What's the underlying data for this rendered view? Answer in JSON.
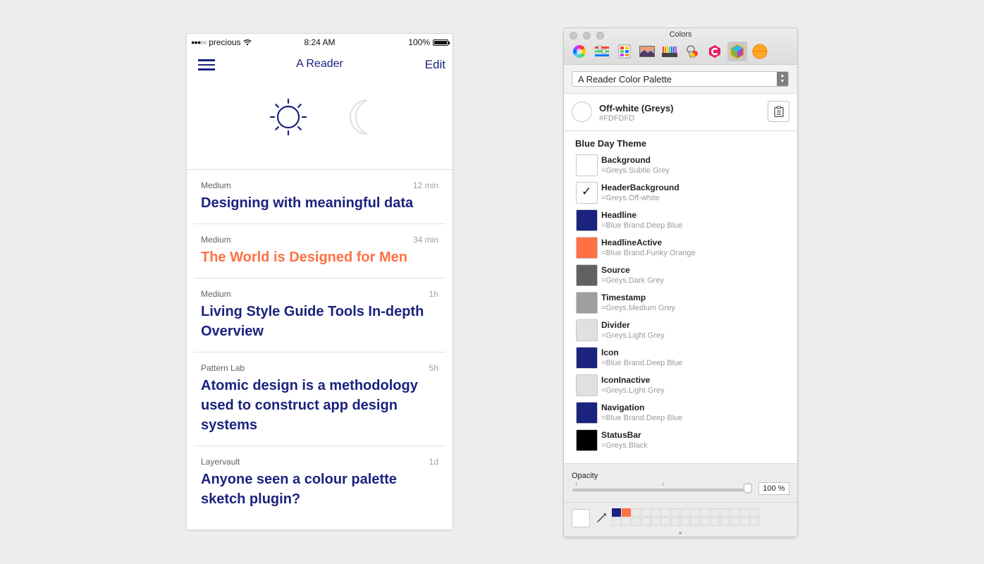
{
  "phone": {
    "statusbar": {
      "carrier": "precious",
      "time": "8:24 AM",
      "battery": "100%"
    },
    "navbar": {
      "title": "A Reader",
      "edit_label": "Edit"
    },
    "theme_toggle": {
      "day_icon": "sun-icon",
      "night_icon": "moon-icon",
      "selected": "day"
    },
    "articles": [
      {
        "source": "Medium",
        "time": "12 min",
        "title": "Designing with meaningful data",
        "active": false
      },
      {
        "source": "Medium",
        "time": "34 min",
        "title": "The World is Designed for Men",
        "active": true
      },
      {
        "source": "Medium",
        "time": "1h",
        "title": "Living Style Guide Tools In-depth Overview",
        "active": false
      },
      {
        "source": "Pattern Lab",
        "time": "5h",
        "title": "Atomic design is a methodology used to construct app design systems",
        "active": false
      },
      {
        "source": "Layervault",
        "time": "1d",
        "title": "Anyone seen a colour palette sketch plugin?",
        "active": false
      }
    ]
  },
  "colors_panel": {
    "window_title": "Colors",
    "palette_select": "A Reader Color Palette",
    "selected_color": {
      "name": "Off-white (Greys)",
      "hex": "#FDFDFD"
    },
    "theme_heading": "Blue Day Theme",
    "theme_colors": [
      {
        "name": "Background",
        "ref": "=Greys.Subtle Grey",
        "color": "#ffffff",
        "checked": false
      },
      {
        "name": "HeaderBackground",
        "ref": "=Greys.Off-white",
        "color": "#fdfdfd",
        "checked": true
      },
      {
        "name": "Headline",
        "ref": "=Blue Brand.Deep Blue",
        "color": "#1a237e",
        "checked": false
      },
      {
        "name": "HeadlineActive",
        "ref": "=Blue Brand.Funky Orange",
        "color": "#ff7043",
        "checked": false
      },
      {
        "name": "Source",
        "ref": "=Greys.Dark Grey",
        "color": "#616161",
        "checked": false
      },
      {
        "name": "Timestamp",
        "ref": "=Greys.Medium Grey",
        "color": "#9e9e9e",
        "checked": false
      },
      {
        "name": "Divider",
        "ref": "=Greys.Light Grey",
        "color": "#e0e0e0",
        "checked": false
      },
      {
        "name": "Icon",
        "ref": "=Blue Brand.Deep Blue",
        "color": "#1a237e",
        "checked": false
      },
      {
        "name": "IconInactive",
        "ref": "=Greys.Light Grey",
        "color": "#e0e0e0",
        "checked": false
      },
      {
        "name": "Navigation",
        "ref": "=Blue Brand.Deep Blue",
        "color": "#1a237e",
        "checked": false
      },
      {
        "name": "StatusBar",
        "ref": "=Greys.Black",
        "color": "#000000",
        "checked": false
      }
    ],
    "opacity_label": "Opacity",
    "opacity_value": "100 %",
    "saved_wells": [
      "#1a237e",
      "#ff7043"
    ],
    "modes": [
      "color-wheel-icon",
      "color-sliders-icon",
      "color-palettes-icon",
      "image-palettes-icon",
      "crayons-icon",
      "paint-bucket-icon",
      "c-plugin-icon",
      "palette-cube-icon",
      "orange-circle-icon"
    ]
  },
  "colors": {
    "deep_blue": "#1a237e",
    "funky_orange": "#ff7043",
    "background": "#eeeeee"
  }
}
